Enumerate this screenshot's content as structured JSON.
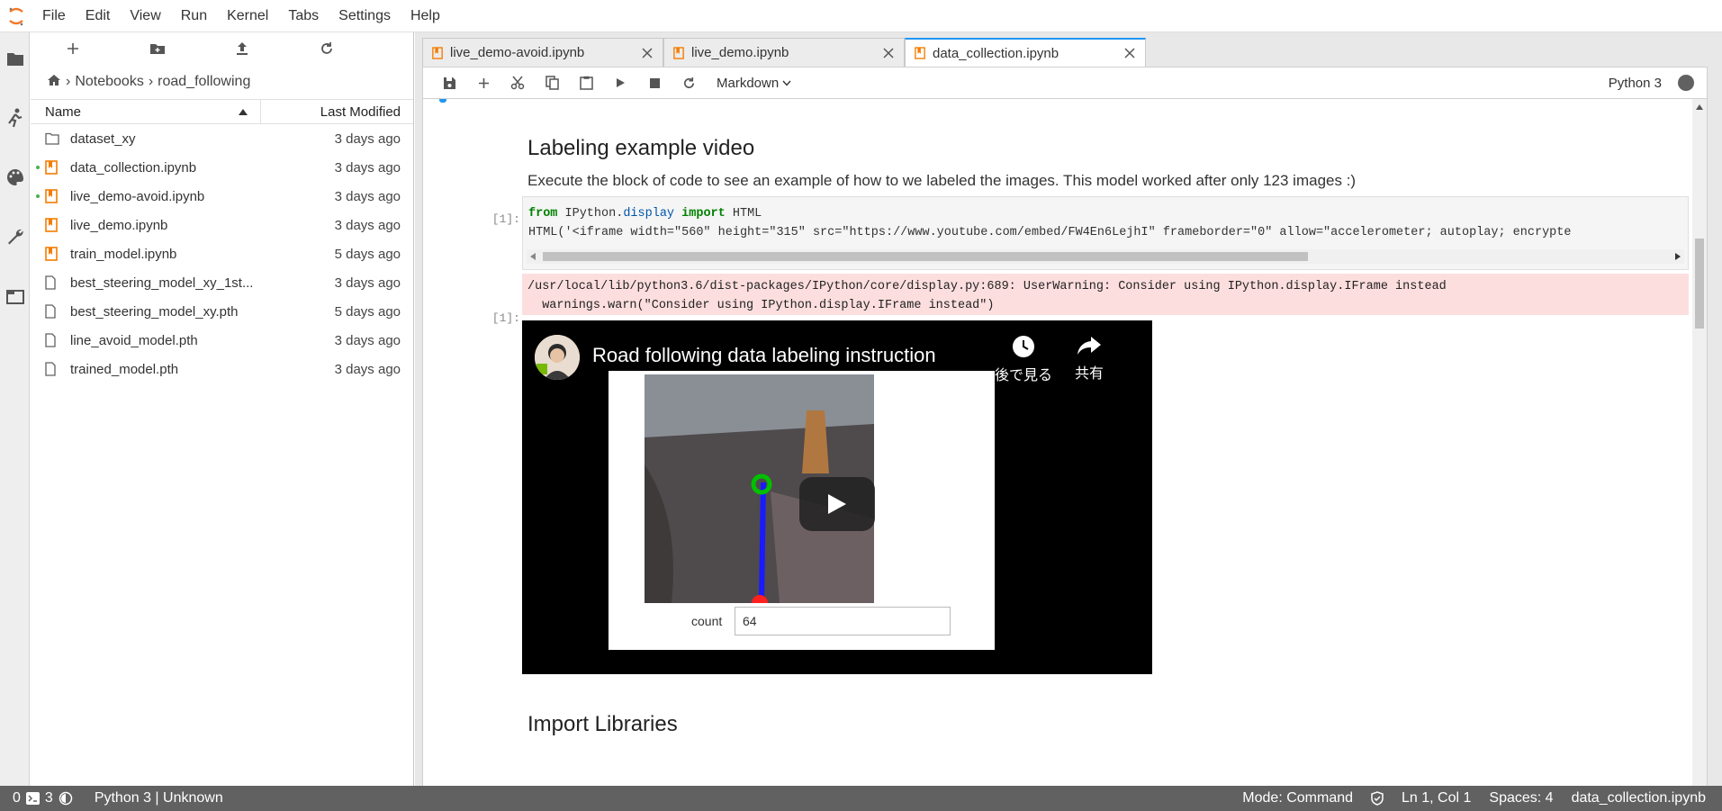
{
  "menu": [
    "File",
    "Edit",
    "View",
    "Run",
    "Kernel",
    "Tabs",
    "Settings",
    "Help"
  ],
  "breadcrumb": [
    "Notebooks",
    "road_following"
  ],
  "file_header": {
    "name": "Name",
    "modified": "Last Modified"
  },
  "files": [
    {
      "name": "dataset_xy",
      "modified": "3 days ago",
      "type": "folder",
      "running": false
    },
    {
      "name": "data_collection.ipynb",
      "modified": "3 days ago",
      "type": "notebook",
      "running": true
    },
    {
      "name": "live_demo-avoid.ipynb",
      "modified": "3 days ago",
      "type": "notebook",
      "running": true
    },
    {
      "name": "live_demo.ipynb",
      "modified": "3 days ago",
      "type": "notebook",
      "running": false
    },
    {
      "name": "train_model.ipynb",
      "modified": "5 days ago",
      "type": "notebook",
      "running": false
    },
    {
      "name": "best_steering_model_xy_1st...",
      "modified": "3 days ago",
      "type": "file",
      "running": false
    },
    {
      "name": "best_steering_model_xy.pth",
      "modified": "5 days ago",
      "type": "file",
      "running": false
    },
    {
      "name": "line_avoid_model.pth",
      "modified": "3 days ago",
      "type": "file",
      "running": false
    },
    {
      "name": "trained_model.pth",
      "modified": "3 days ago",
      "type": "file",
      "running": false
    }
  ],
  "tabs": [
    {
      "label": "live_demo-avoid.ipynb",
      "active": false
    },
    {
      "label": "live_demo.ipynb",
      "active": false
    },
    {
      "label": "data_collection.ipynb",
      "active": true
    }
  ],
  "notebook_toolbar": {
    "cell_type": "Markdown",
    "kernel": "Python 3"
  },
  "cells": {
    "heading1": "Labeling example video",
    "paragraph1": "Execute the block of code to see an example of how to we labeled the images. This model worked after only 123 images :)",
    "code_prompt": "[1]:",
    "code_line2": "HTML('<iframe width=\"560\" height=\"315\" src=\"https://www.youtube.com/embed/FW4En6LejhI\" frameborder=\"0\" allow=\"accelerometer; autoplay; encrypte",
    "stderr_line1": "/usr/local/lib/python3.6/dist-packages/IPython/core/display.py:689: UserWarning: Consider using IPython.display.IFrame instead",
    "stderr_line2": "  warnings.warn(\"Consider using IPython.display.IFrame instead\")",
    "output_prompt": "[1]:",
    "video_title": "Road following data labeling instruction",
    "watch_later": "後で見る",
    "share": "共有",
    "count_label": "count",
    "count_value": "64",
    "heading2": "Import Libraries"
  },
  "statusbar": {
    "terminals": "0",
    "kernels": "3",
    "kernel": "Python 3 | Unknown",
    "mode": "Mode: Command",
    "position": "Ln 1, Col 1",
    "spaces": "Spaces: 4",
    "file": "data_collection.ipynb"
  },
  "colors": {
    "accent": "#2196f3",
    "notebook_icon": "#f57c00",
    "running_dot": "#4caf50",
    "stderr_bg": "#fddede"
  }
}
